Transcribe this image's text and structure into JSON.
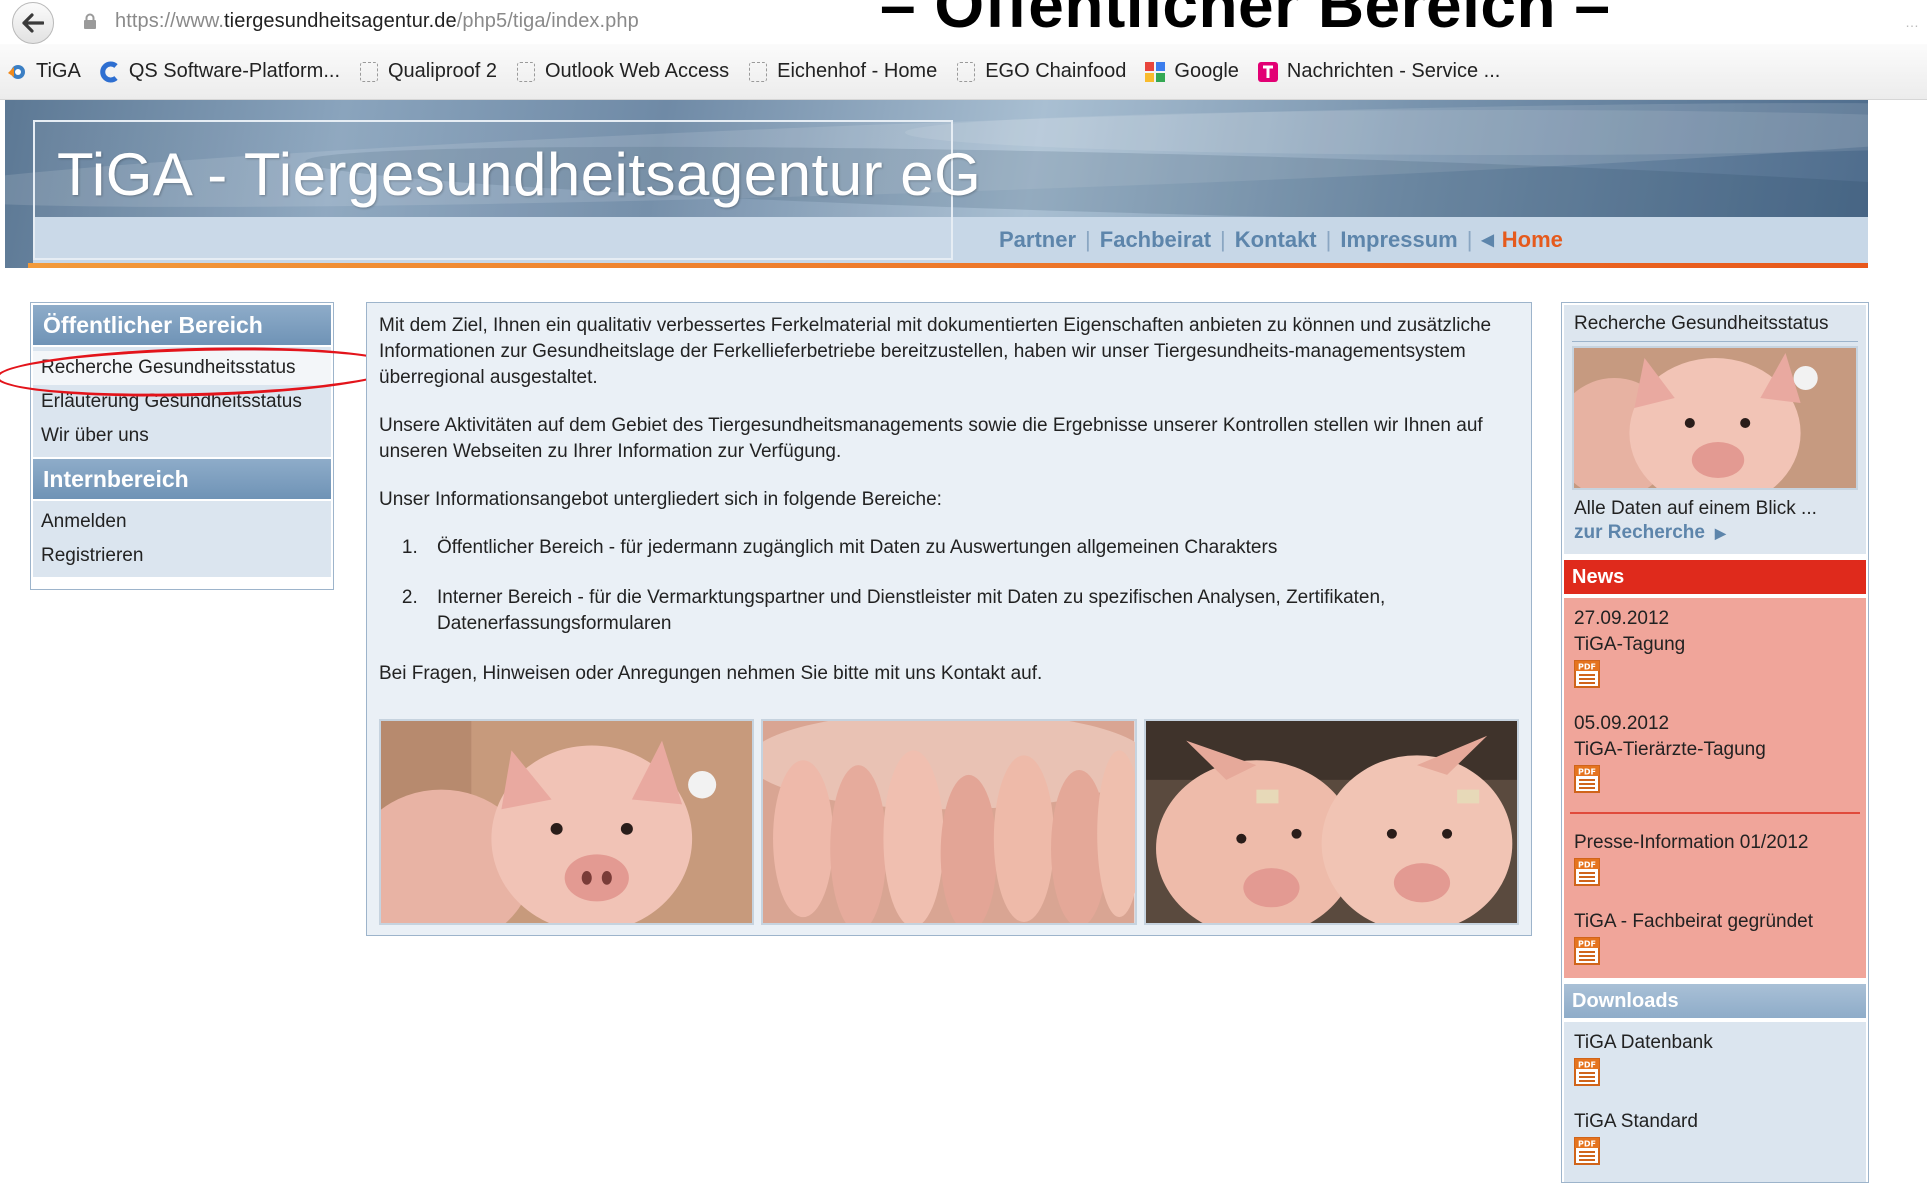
{
  "browser": {
    "url_prefix": "https://www.",
    "url_domain": "tiergesundheitsagentur.de",
    "url_path": "/php5/tiga/index.php",
    "bookmarks": [
      {
        "label": "TiGA",
        "icon": "tiga-icon"
      },
      {
        "label": "QS Software-Platform...",
        "icon": "qs-icon"
      },
      {
        "label": "Qualiproof 2",
        "icon": "page-icon"
      },
      {
        "label": "Outlook Web Access",
        "icon": "page-icon"
      },
      {
        "label": "Eichenhof - Home",
        "icon": "page-icon"
      },
      {
        "label": "EGO Chainfood",
        "icon": "page-icon"
      },
      {
        "label": "Google",
        "icon": "google-icon"
      },
      {
        "label": "Nachrichten - Service ...",
        "icon": "telekom-icon"
      }
    ]
  },
  "slide_title": "– Öffentlicher Bereich –",
  "header": {
    "logo": "TiGA - Tiergesundheitsagentur eG",
    "nav": {
      "partner": "Partner",
      "fachbeirat": "Fachbeirat",
      "kontakt": "Kontakt",
      "impressum": "Impressum",
      "home": "Home",
      "sep": "|"
    }
  },
  "leftnav": {
    "public_head": "Öffentlicher Bereich",
    "public_items": [
      "Recherche Gesundheitsstatus",
      "Erläuterung Gesundheitsstatus",
      "Wir über uns"
    ],
    "intern_head": "Internbereich",
    "intern_items": [
      "Anmelden",
      "Registrieren"
    ]
  },
  "content": {
    "p1": "Mit dem Ziel, Ihnen ein qualitativ verbessertes Ferkelmaterial mit dokumentierten Eigenschaften anbieten zu können und zusätzliche Informationen zur Gesundheitslage der Ferkellieferbetriebe bereitzustellen, haben wir unser Tiergesundheits-managementsystem überregional ausgestaltet.",
    "p2": "Unsere Aktivitäten auf dem Gebiet des Tiergesundheitsmanagements sowie die Ergebnisse unserer Kontrollen stellen wir Ihnen auf unseren Webseiten zu Ihrer Information zur Verfügung.",
    "p3": "Unser Informationsangebot untergliedert sich in folgende Bereiche:",
    "list": [
      "Öffentlicher Bereich - für jedermann zugänglich mit Daten zu Auswertungen allgemeinen Charakters",
      "Interner Bereich - für die Vermarktungspartner und Dienstleister mit Daten zu spezifischen Analysen, Zertifikaten, Datenerfassungsformularen"
    ],
    "p4": "Bei Fragen, Hinweisen oder Anregungen nehmen Sie bitte mit uns Kontakt auf."
  },
  "rightcol": {
    "recherche_title": "Recherche Gesundheitsstatus",
    "recherche_text": "Alle Daten auf einem Blick ...",
    "recherche_link": "zur Recherche",
    "news_head": "News",
    "news": [
      {
        "date": "27.09.2012",
        "title": "TiGA-Tagung"
      },
      {
        "date": "05.09.2012",
        "title": "TiGA-Tierärzte-Tagung"
      }
    ],
    "press": [
      {
        "title": "Presse-Information 01/2012"
      },
      {
        "title": "TiGA - Fachbeirat gegründet"
      }
    ],
    "downloads_head": "Downloads",
    "downloads": [
      {
        "title": "TiGA Datenbank"
      },
      {
        "title": "TiGA Standard"
      }
    ],
    "pdf_label": "PDF"
  },
  "colors": {
    "accent_blue": "#5d85ab",
    "home_orange": "#e55a1d",
    "news_red": "#df2a1c",
    "news_bg": "#f0a59a",
    "highlight_oval": "#e3141b"
  }
}
